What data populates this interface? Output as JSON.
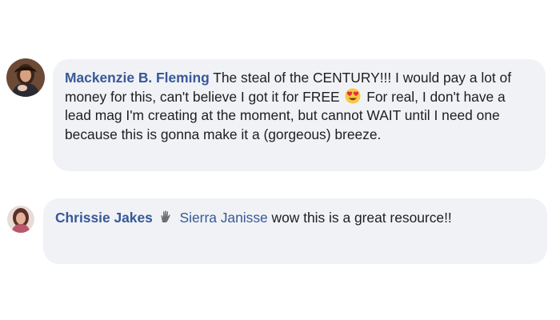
{
  "comments": [
    {
      "author": "Mackenzie B. Fleming",
      "text_part1": "The steal of the CENTURY!!! I would pay a lot of money for this, can't believe I got it for FREE",
      "emoji": "heart-eyes-emoji",
      "text_part2": "For real, I don't have a lead mag I'm creating at the moment, but cannot WAIT until I need one because this is gonna make it a (gorgeous) breeze."
    },
    {
      "author": "Chrissie Jakes",
      "badge": "top-fan-badge-icon",
      "mention": "Sierra Janisse",
      "text": "wow this is a great resource!!"
    }
  ],
  "colors": {
    "bubble_bg": "#f0f2f5",
    "author": "#385898",
    "text": "#1c1e21"
  }
}
